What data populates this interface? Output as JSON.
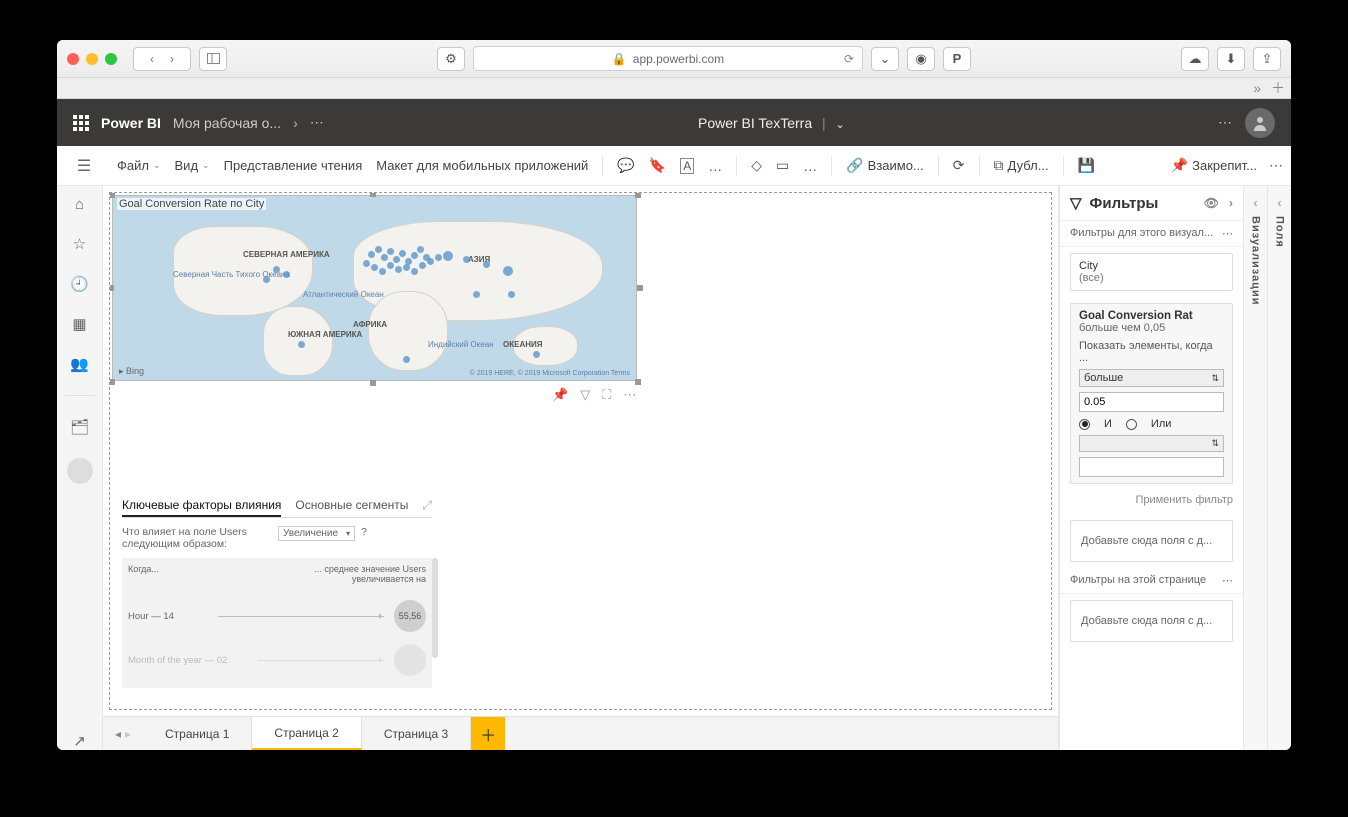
{
  "browser": {
    "url_host": "app.powerbi.com"
  },
  "pbi_header": {
    "brand": "Power BI",
    "workspace": "Моя рабочая о...",
    "title": "Power BI TexTerra"
  },
  "ribbon": {
    "file": "Файл",
    "view": "Вид",
    "reading_view": "Представление чтения",
    "mobile_layout": "Макет для мобильных приложений",
    "related": "Взаимо...",
    "duplicate": "Дубл...",
    "pin": "Закрепит..."
  },
  "map": {
    "title": "Goal Conversion Rate по City",
    "credits": "© 2019 HERE, © 2019 Microsoft Corporation Terms",
    "labels": {
      "na": "СЕВЕРНАЯ\nАМЕРИКА",
      "sa": "ЮЖНАЯ АМЕРИКА",
      "africa": "АФРИКА",
      "asia": "АЗИЯ",
      "oceania": "ОКЕАНИЯ",
      "pacific": "Северная\nЧасть\nТихого\nОкеана",
      "atlantic": "Атлантический\nОкеан",
      "indian": "Индийский\nОкеан"
    },
    "bing": "Bing"
  },
  "key_infl": {
    "tab1": "Ключевые факторы влияния",
    "tab2": "Основные сегменты",
    "question_a": "Что влияет на поле Users следующим образом:",
    "direction": "Увеличение",
    "qmark": "?",
    "col_when": "Когда...",
    "col_then": "... среднее значение Users увеличивается на",
    "row1_label": "Hour — 14",
    "row1_value": "55,56",
    "row2_label": "Month of the year — 02"
  },
  "pages": {
    "p1": "Страница 1",
    "p2": "Страница 2",
    "p3": "Страница 3"
  },
  "filters": {
    "title": "Фильтры",
    "visual_section": "Фильтры для этого визуал...",
    "card1_field": "City",
    "card1_value": "(все)",
    "card2_field": "Goal Conversion Rat",
    "card2_cond": "больше чем 0,05",
    "show_when": "Показать элементы, когда ...",
    "op1": "больше",
    "val1": "0.05",
    "radio_and": "И",
    "radio_or": "Или",
    "apply": "Применить фильтр",
    "drop1": "Добавьте сюда поля с д...",
    "page_section": "Фильтры на этой странице",
    "drop2": "Добавьте сюда поля с д..."
  },
  "side_panes": {
    "viz": "Визуализации",
    "fields": "Поля"
  }
}
